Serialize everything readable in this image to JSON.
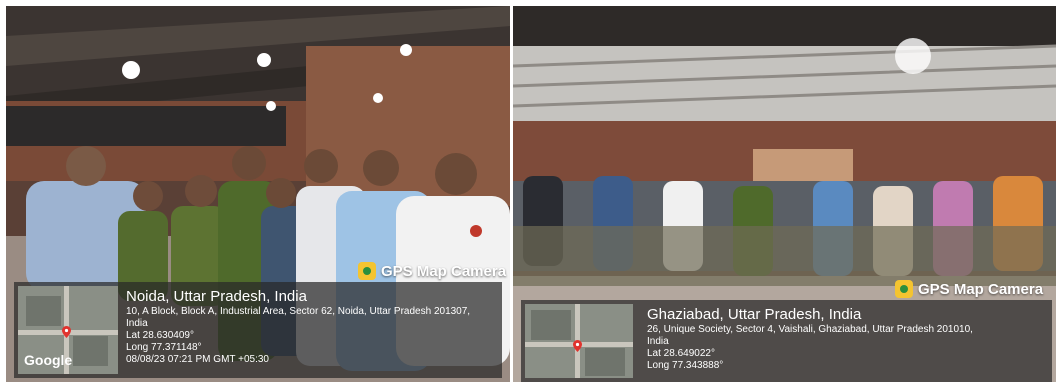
{
  "left_photo": {
    "badge_label": "GPS Map Camera",
    "location_title": "Noida, Uttar Pradesh, India",
    "address_line1": "10, A Block, Block A, Industrial Area, Sector 62, Noida, Uttar Pradesh 201307,",
    "address_line2": "India",
    "lat": "Lat 28.630409°",
    "long": "Long 77.371148°",
    "timestamp": "08/08/23 07:21 PM GMT +05:30",
    "map_logo": "Google"
  },
  "right_photo": {
    "badge_label": "GPS Map Camera",
    "location_title": "Ghaziabad, Uttar Pradesh, India",
    "address_line1": "26, Unique Society, Sector 4, Vaishali, Ghaziabad, Uttar Pradesh 201010,",
    "address_line2": "India",
    "lat": "Lat 28.649022°",
    "long": "Long 77.343888°"
  },
  "colors": {
    "overlay_bg": "#282828",
    "pin_red": "#e0332e",
    "badge_yellow": "#f4c430"
  }
}
